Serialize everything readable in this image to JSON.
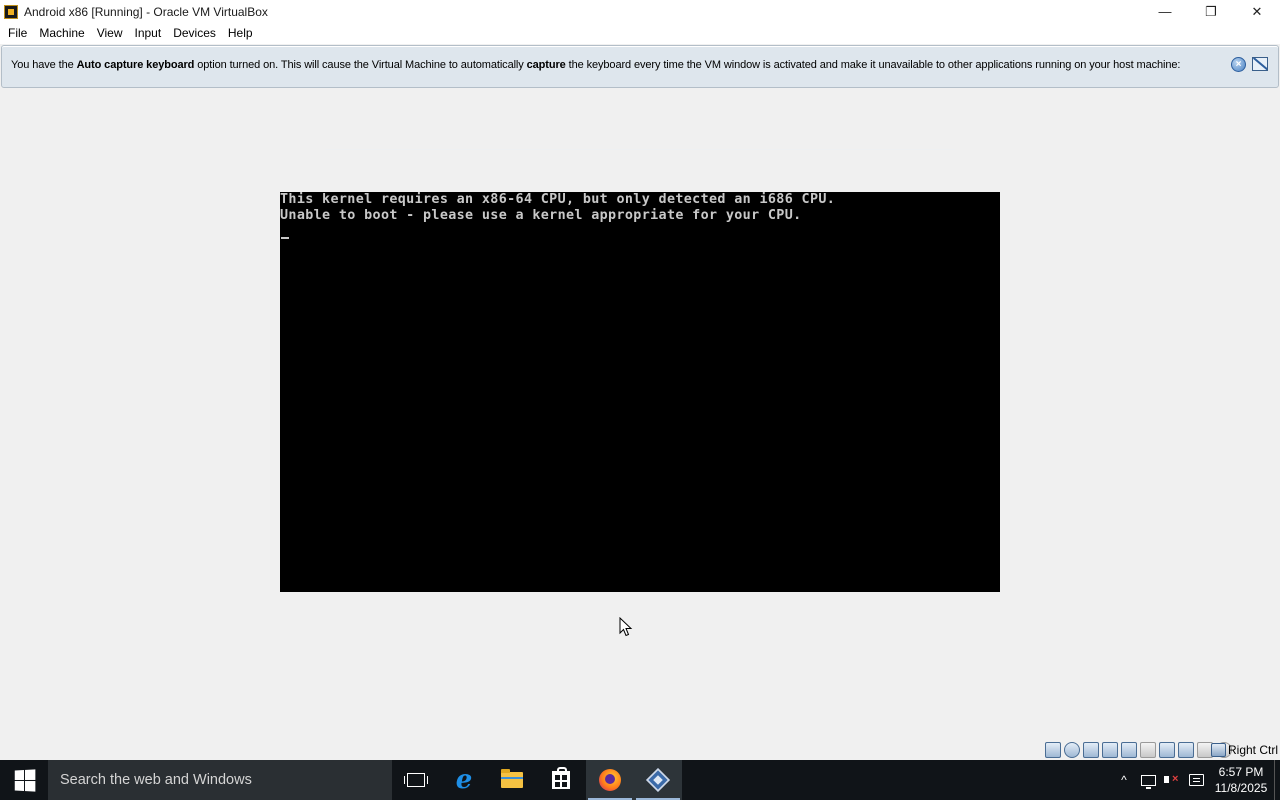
{
  "window": {
    "title": "Android x86 [Running] - Oracle VM VirtualBox",
    "minimize_glyph": "—",
    "restore_glyph": "❐",
    "close_glyph": "✕"
  },
  "menu": {
    "items": [
      "File",
      "Machine",
      "View",
      "Input",
      "Devices",
      "Help"
    ]
  },
  "banner": {
    "part1": "You have the ",
    "bold1": "Auto capture keyboard",
    "part2": " option turned on. This will cause the Virtual Machine to automatically ",
    "bold2": "capture",
    "part3": " the keyboard every time the VM window is activated and make it unavailable to other applications running on your host machine:"
  },
  "console": {
    "line1": "This kernel requires an x86-64 CPU, but only detected an i686 CPU.",
    "line2": "Unable to boot - please use a kernel appropriate for your CPU."
  },
  "statusbar": {
    "icons": [
      "hard-disk-icon",
      "optical-drive-icon",
      "audio-icon",
      "network-icon",
      "usb-icon",
      "shared-folders-icon",
      "display-icon",
      "video-capture-icon",
      "cpu-icon",
      "mouse-integration-icon",
      "host-key-icon"
    ],
    "host_key": "Right Ctrl"
  },
  "taskbar": {
    "search_placeholder": "Search the web and Windows",
    "pinned": [
      "task-view-icon",
      "edge-icon",
      "file-explorer-icon",
      "store-icon",
      "firefox-icon",
      "virtualbox-icon"
    ],
    "tray": {
      "chevron": "^",
      "time": "6:57 PM",
      "date": "11/8/2025"
    }
  },
  "colors": {
    "banner_bg": "#dee6ed",
    "vm_screen": "#000000",
    "console_text": "#c8c8c8",
    "taskbar_bg": "#101418"
  }
}
